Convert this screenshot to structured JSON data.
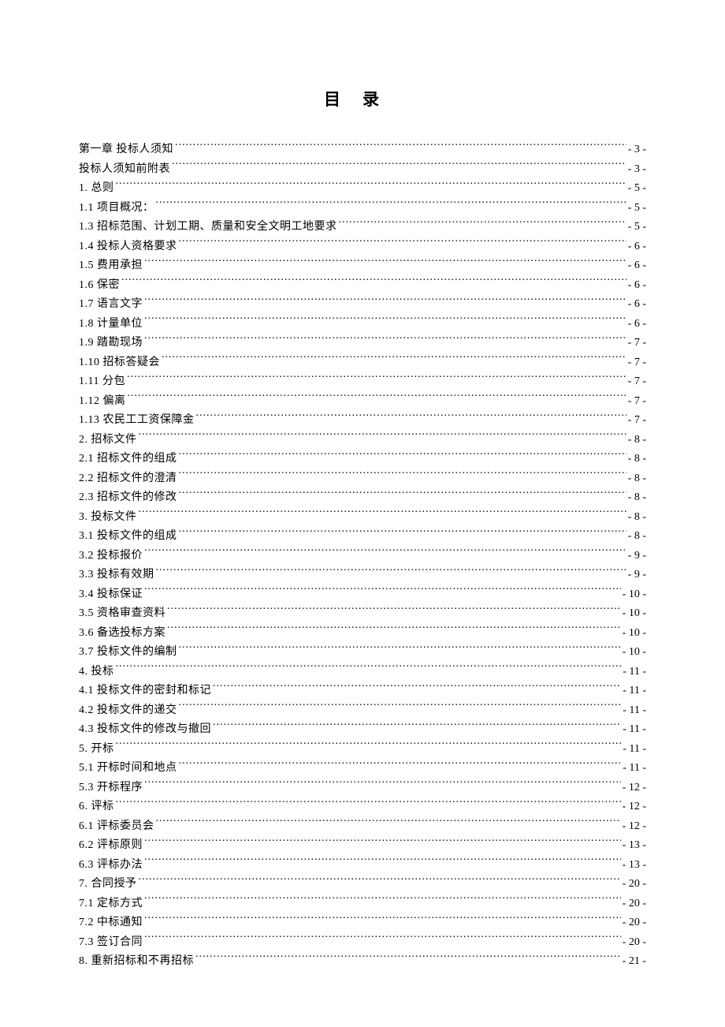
{
  "title": "目录",
  "toc": [
    {
      "label": "第一章 投标人须知",
      "page": "- 3 -"
    },
    {
      "label": "投标人须知前附表",
      "page": "- 3 -"
    },
    {
      "label": "1. 总则",
      "page": "- 5 -"
    },
    {
      "label": "1.1 项目概况：",
      "page": "- 5 -"
    },
    {
      "label": "1.3 招标范围、计划工期、质量和安全文明工地要求",
      "page": "- 5 -"
    },
    {
      "label": "1.4 投标人资格要求",
      "page": "- 6 -"
    },
    {
      "label": "1.5 费用承担",
      "page": "- 6 -"
    },
    {
      "label": "1.6 保密",
      "page": "- 6 -"
    },
    {
      "label": "1.7 语言文字",
      "page": "- 6 -"
    },
    {
      "label": "1.8 计量单位",
      "page": "- 6 -"
    },
    {
      "label": "1.9 踏勘现场",
      "page": "- 7 -"
    },
    {
      "label": "1.10 招标答疑会",
      "page": "- 7 -"
    },
    {
      "label": "1.11 分包",
      "page": "- 7 -"
    },
    {
      "label": "1.12 偏离",
      "page": "- 7 -"
    },
    {
      "label": "1.13 农民工工资保障金",
      "page": "- 7 -"
    },
    {
      "label": "2. 招标文件",
      "page": "- 8 -"
    },
    {
      "label": "2.1 招标文件的组成",
      "page": "- 8 -"
    },
    {
      "label": "2.2 招标文件的澄清",
      "page": "- 8 -"
    },
    {
      "label": "2.3 招标文件的修改",
      "page": "- 8 -"
    },
    {
      "label": "3. 投标文件",
      "page": "- 8 -"
    },
    {
      "label": "3.1 投标文件的组成",
      "page": "- 8 -"
    },
    {
      "label": "3.2 投标报价",
      "page": "- 9 -"
    },
    {
      "label": "3.3 投标有效期",
      "page": "- 9 -"
    },
    {
      "label": "3.4 投标保证",
      "page": "- 10 -"
    },
    {
      "label": "3.5 资格审查资料",
      "page": "- 10 -"
    },
    {
      "label": "3.6 备选投标方案",
      "page": "- 10 -"
    },
    {
      "label": "3.7 投标文件的编制",
      "page": "- 10 -"
    },
    {
      "label": "4. 投标",
      "page": "- 11 -"
    },
    {
      "label": "4.1 投标文件的密封和标记",
      "page": "- 11 -"
    },
    {
      "label": "4.2 投标文件的递交",
      "page": "- 11 -"
    },
    {
      "label": "4.3 投标文件的修改与撤回",
      "page": "- 11 -"
    },
    {
      "label": "5. 开标",
      "page": "- 11 -"
    },
    {
      "label": "5.1 开标时间和地点",
      "page": "- 11 -"
    },
    {
      "label": "5.3 开标程序",
      "page": "- 12 -"
    },
    {
      "label": "6. 评标",
      "page": "- 12 -"
    },
    {
      "label": "6.1 评标委员会",
      "page": "- 12 -"
    },
    {
      "label": "6.2 评标原则",
      "page": "- 13 -"
    },
    {
      "label": "6.3 评标办法",
      "page": "- 13 -"
    },
    {
      "label": "7. 合同授予",
      "page": "- 20 -"
    },
    {
      "label": "7.1 定标方式",
      "page": "- 20 -"
    },
    {
      "label": "7.2 中标通知",
      "page": "- 20 -"
    },
    {
      "label": "7.3 签订合同",
      "page": "- 20 -"
    },
    {
      "label": "8. 重新招标和不再招标",
      "page": "- 21 -"
    }
  ]
}
